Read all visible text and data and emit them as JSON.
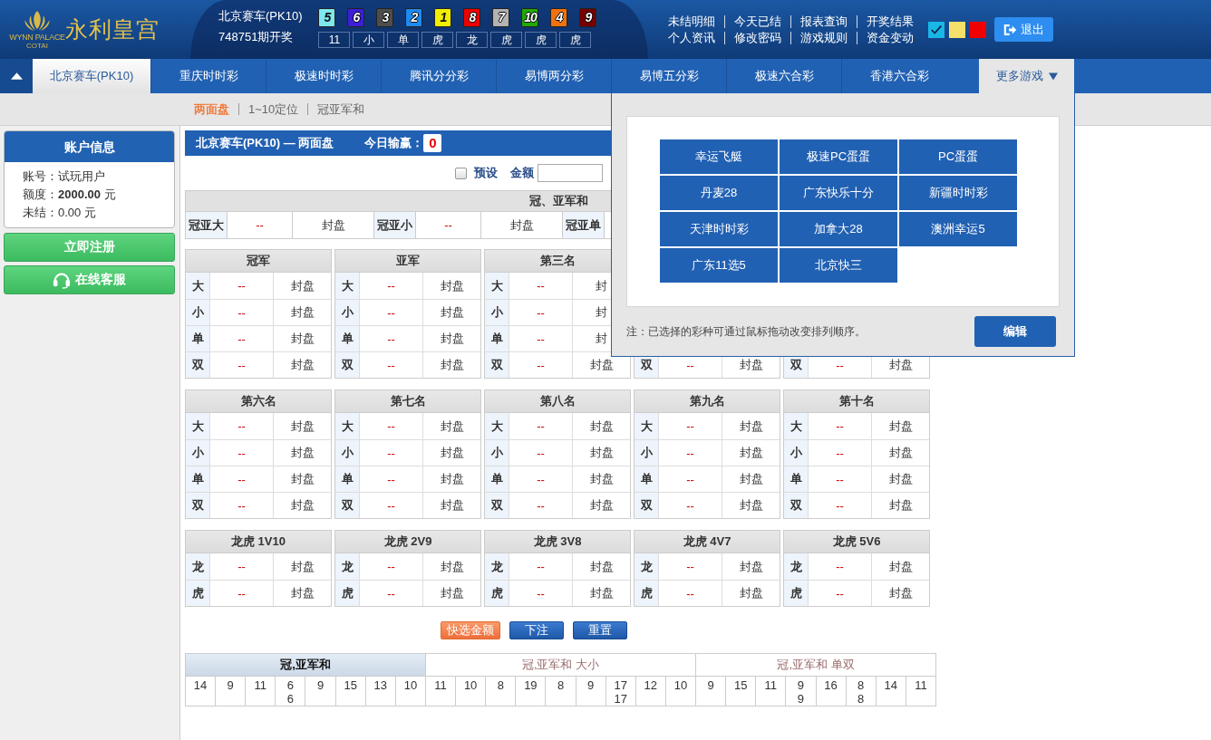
{
  "header": {
    "logo": {
      "name_en": "WYNN PALACE",
      "sub": "COTAI",
      "name_cn": "永利皇宫"
    },
    "lottery": {
      "name": "北京赛车(PK10)",
      "period": "748751期开奖",
      "balls": [
        {
          "number": "5",
          "color": "#7ee8ef"
        },
        {
          "number": "6",
          "color": "#3b1fd6"
        },
        {
          "number": "3",
          "color": "#4d4d4d"
        },
        {
          "number": "2",
          "color": "#1e8af0"
        },
        {
          "number": "1",
          "color": "#f2ee00"
        },
        {
          "number": "8",
          "color": "#ee0000"
        },
        {
          "number": "7",
          "color": "#b3b3b3"
        },
        {
          "number": "10",
          "color": "#21a900"
        },
        {
          "number": "4",
          "color": "#f0720f"
        },
        {
          "number": "9",
          "color": "#760000"
        }
      ],
      "results": [
        "11",
        "小",
        "单",
        "虎",
        "龙",
        "虎",
        "虎",
        "虎"
      ]
    },
    "link_rows": [
      [
        "未结明细",
        "今天已结",
        "报表查询",
        "开奖结果"
      ],
      [
        "个人资讯",
        "修改密码",
        "游戏规则",
        "资金变动"
      ]
    ],
    "themes": [
      {
        "color": "#19b6e8",
        "selected": true
      },
      {
        "color": "#f5e06a",
        "selected": false
      },
      {
        "color": "#f00000",
        "selected": false
      }
    ],
    "logout": "退出"
  },
  "nav": {
    "tabs": [
      {
        "label": "北京赛车(PK10)",
        "selected": true
      },
      {
        "label": "重庆时时彩",
        "selected": false
      },
      {
        "label": "极速时时彩",
        "selected": false
      },
      {
        "label": "腾讯分分彩",
        "selected": false
      },
      {
        "label": "易博两分彩",
        "selected": false
      },
      {
        "label": "易博五分彩",
        "selected": false
      },
      {
        "label": "极速六合彩",
        "selected": false
      },
      {
        "label": "香港六合彩",
        "selected": false
      }
    ],
    "more": {
      "label": "更多游戏",
      "expanded": true
    }
  },
  "subnav": [
    {
      "label": "两面盘",
      "selected": true
    },
    {
      "label": "1~10定位",
      "selected": false
    },
    {
      "label": "冠亚军和",
      "selected": false
    }
  ],
  "sidebar": {
    "account": {
      "title": "账户信息",
      "lines": [
        "账号：试玩用户",
        "额度：**2000.00** 元",
        "未结：0.00 元"
      ]
    },
    "buttons": [
      {
        "label": "立即注册",
        "kind": "register"
      },
      {
        "label": "在线客服",
        "kind": "support"
      }
    ]
  },
  "board": {
    "title": "北京赛车(PK10) — 两面盘",
    "today_label": "今日输赢：",
    "today_value": "0",
    "preset": {
      "label": "预设",
      "checked": false
    },
    "amount_label": "金额",
    "sum_section": {
      "title": "冠、亚军和",
      "cells": [
        {
          "kind": "label",
          "text": "冠亚大"
        },
        {
          "kind": "odds",
          "text": "--"
        },
        {
          "kind": "status",
          "text": "封盘"
        },
        {
          "kind": "label",
          "text": "冠亚小"
        },
        {
          "kind": "odds",
          "text": "--"
        },
        {
          "kind": "status",
          "text": "封盘"
        },
        {
          "kind": "label",
          "text": "冠亚单"
        }
      ]
    },
    "groups": [
      {
        "columns": [
          {
            "title": "冠军",
            "rows": [
              {
                "label": "大",
                "odds": "--",
                "status": "封盘"
              },
              {
                "label": "小",
                "odds": "--",
                "status": "封盘"
              },
              {
                "label": "单",
                "odds": "--",
                "status": "封盘"
              },
              {
                "label": "双",
                "odds": "--",
                "status": "封盘"
              }
            ]
          },
          {
            "title": "亚军",
            "rows": [
              {
                "label": "大",
                "odds": "--",
                "status": "封盘"
              },
              {
                "label": "小",
                "odds": "--",
                "status": "封盘"
              },
              {
                "label": "单",
                "odds": "--",
                "status": "封盘"
              },
              {
                "label": "双",
                "odds": "--",
                "status": "封盘"
              }
            ]
          },
          {
            "title": "第三名",
            "rows": [
              {
                "label": "大",
                "odds": "--",
                "status": "封"
              },
              {
                "label": "小",
                "odds": "--",
                "status": "封"
              },
              {
                "label": "单",
                "odds": "--",
                "status": "封"
              },
              {
                "label": "双",
                "odds": "--",
                "status": "封盘"
              }
            ]
          },
          {
            "rows": [
              {
                "label": "双",
                "odds": "--",
                "status": "封盘"
              }
            ]
          },
          {
            "rows": [
              {
                "label": "双",
                "odds": "--",
                "status": "封盘"
              }
            ]
          }
        ]
      },
      {
        "columns": [
          {
            "title": "第六名",
            "rows": [
              {
                "label": "大",
                "odds": "--",
                "status": "封盘"
              },
              {
                "label": "小",
                "odds": "--",
                "status": "封盘"
              },
              {
                "label": "单",
                "odds": "--",
                "status": "封盘"
              },
              {
                "label": "双",
                "odds": "--",
                "status": "封盘"
              }
            ]
          },
          {
            "title": "第七名",
            "rows": [
              {
                "label": "大",
                "odds": "--",
                "status": "封盘"
              },
              {
                "label": "小",
                "odds": "--",
                "status": "封盘"
              },
              {
                "label": "单",
                "odds": "--",
                "status": "封盘"
              },
              {
                "label": "双",
                "odds": "--",
                "status": "封盘"
              }
            ]
          },
          {
            "title": "第八名",
            "rows": [
              {
                "label": "大",
                "odds": "--",
                "status": "封盘"
              },
              {
                "label": "小",
                "odds": "--",
                "status": "封盘"
              },
              {
                "label": "单",
                "odds": "--",
                "status": "封盘"
              },
              {
                "label": "双",
                "odds": "--",
                "status": "封盘"
              }
            ]
          },
          {
            "title": "第九名",
            "rows": [
              {
                "label": "大",
                "odds": "--",
                "status": "封盘"
              },
              {
                "label": "小",
                "odds": "--",
                "status": "封盘"
              },
              {
                "label": "单",
                "odds": "--",
                "status": "封盘"
              },
              {
                "label": "双",
                "odds": "--",
                "status": "封盘"
              }
            ]
          },
          {
            "title": "第十名",
            "rows": [
              {
                "label": "大",
                "odds": "--",
                "status": "封盘"
              },
              {
                "label": "小",
                "odds": "--",
                "status": "封盘"
              },
              {
                "label": "单",
                "odds": "--",
                "status": "封盘"
              },
              {
                "label": "双",
                "odds": "--",
                "status": "封盘"
              }
            ]
          }
        ]
      },
      {
        "columns": [
          {
            "title": "龙虎 1V10",
            "rows": [
              {
                "label": "龙",
                "odds": "--",
                "status": "封盘"
              },
              {
                "label": "虎",
                "odds": "--",
                "status": "封盘"
              }
            ]
          },
          {
            "title": "龙虎 2V9",
            "rows": [
              {
                "label": "龙",
                "odds": "--",
                "status": "封盘"
              },
              {
                "label": "虎",
                "odds": "--",
                "status": "封盘"
              }
            ]
          },
          {
            "title": "龙虎 3V8",
            "rows": [
              {
                "label": "龙",
                "odds": "--",
                "status": "封盘"
              },
              {
                "label": "虎",
                "odds": "--",
                "status": "封盘"
              }
            ]
          },
          {
            "title": "龙虎 4V7",
            "rows": [
              {
                "label": "龙",
                "odds": "--",
                "status": "封盘"
              },
              {
                "label": "虎",
                "odds": "--",
                "status": "封盘"
              }
            ]
          },
          {
            "title": "龙虎 5V6",
            "rows": [
              {
                "label": "龙",
                "odds": "--",
                "status": "封盘"
              },
              {
                "label": "虎",
                "odds": "--",
                "status": "封盘"
              }
            ]
          }
        ]
      }
    ],
    "actions": [
      {
        "label": "快选金额",
        "kind": "quick"
      },
      {
        "label": "下注",
        "kind": "submit"
      },
      {
        "label": "重置",
        "kind": "reset"
      }
    ],
    "stats": [
      {
        "label": "冠,亚军和",
        "selected": true,
        "cells": [
          [
            "14"
          ],
          [
            "9"
          ],
          [
            "11"
          ],
          [
            "6",
            "6"
          ],
          [
            "9"
          ],
          [
            "15"
          ],
          [
            "13"
          ],
          [
            "10"
          ]
        ]
      },
      {
        "label": "冠,亚军和 大小",
        "selected": false,
        "cells": [
          [
            "11"
          ],
          [
            "10"
          ],
          [
            "8"
          ],
          [
            "19"
          ],
          [
            "8"
          ],
          [
            "9"
          ],
          [
            "17",
            "17"
          ],
          [
            "12"
          ],
          [
            "10"
          ]
        ]
      },
      {
        "label": "冠,亚军和 单双",
        "selected": false,
        "cells": [
          [
            "9"
          ],
          [
            "15"
          ],
          [
            "11"
          ],
          [
            "9",
            "9"
          ],
          [
            "16"
          ],
          [
            "8",
            "8"
          ],
          [
            "14"
          ],
          [
            "11"
          ]
        ]
      }
    ]
  },
  "more_games": {
    "games": [
      "幸运飞艇",
      "极速PC蛋蛋",
      "PC蛋蛋",
      "丹麦28",
      "广东快乐十分",
      "新疆时时彩",
      "天津时时彩",
      "加拿大28",
      "澳洲幸运5",
      "广东11选5",
      "北京快三"
    ],
    "note": "注：已选择的彩种可通过鼠标拖动改变排列顺序。",
    "edit": "编辑"
  }
}
